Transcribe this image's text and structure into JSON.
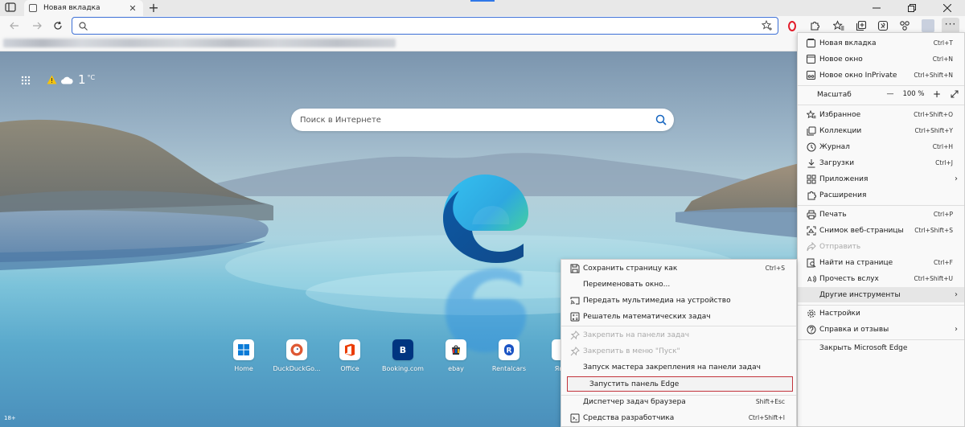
{
  "tab": {
    "title": "Новая вкладка"
  },
  "address": {
    "value": "",
    "placeholder": ""
  },
  "page": {
    "weather_temp": "1",
    "weather_unit": "°C",
    "search_placeholder": "Поиск в Интернете",
    "age_badge": "18+",
    "tiles": [
      {
        "label": "Home",
        "icon": "windows-logo"
      },
      {
        "label": "DuckDuckGo...",
        "icon": "duckduckgo-logo"
      },
      {
        "label": "Office",
        "icon": "office-logo"
      },
      {
        "label": "Booking.com",
        "icon": "booking-logo",
        "glyph": "B"
      },
      {
        "label": "ebay",
        "icon": "ebay-logo"
      },
      {
        "label": "Rentalcars",
        "icon": "rentalcars-logo",
        "glyph": "R"
      },
      {
        "label": "Ян...",
        "icon": "yandex-logo"
      }
    ]
  },
  "main_menu": {
    "new_tab": {
      "label": "Новая вкладка",
      "shortcut": "Ctrl+T"
    },
    "new_window": {
      "label": "Новое окно",
      "shortcut": "Ctrl+N"
    },
    "inprivate": {
      "label": "Новое окно InPrivate",
      "shortcut": "Ctrl+Shift+N"
    },
    "zoom": {
      "label": "Масштаб",
      "minus": "—",
      "value": "100 %",
      "plus": "+"
    },
    "favorites": {
      "label": "Избранное",
      "shortcut": "Ctrl+Shift+O"
    },
    "collections": {
      "label": "Коллекции",
      "shortcut": "Ctrl+Shift+Y"
    },
    "history": {
      "label": "Журнал",
      "shortcut": "Ctrl+H"
    },
    "downloads": {
      "label": "Загрузки",
      "shortcut": "Ctrl+J"
    },
    "apps": {
      "label": "Приложения"
    },
    "extensions": {
      "label": "Расширения"
    },
    "print": {
      "label": "Печать",
      "shortcut": "Ctrl+P"
    },
    "screenshot": {
      "label": "Снимок веб-страницы",
      "shortcut": "Ctrl+Shift+S"
    },
    "share": {
      "label": "Отправить"
    },
    "find": {
      "label": "Найти на странице",
      "shortcut": "Ctrl+F"
    },
    "read_aloud": {
      "label": "Прочесть вслух",
      "shortcut": "Ctrl+Shift+U"
    },
    "more_tools": {
      "label": "Другие инструменты"
    },
    "settings": {
      "label": "Настройки"
    },
    "help": {
      "label": "Справка и отзывы"
    },
    "close_edge": {
      "label": "Закрыть Microsoft Edge"
    }
  },
  "sub_menu": {
    "save_page": {
      "label": "Сохранить страницу как",
      "shortcut": "Ctrl+S"
    },
    "rename_window": {
      "label": "Переименовать окно..."
    },
    "cast_media": {
      "label": "Передать мультимедиа на устройство"
    },
    "math_solver": {
      "label": "Решатель математических задач"
    },
    "pin_taskbar": {
      "label": "Закрепить на панели задач"
    },
    "pin_start": {
      "label": "Закрепить в меню \"Пуск\""
    },
    "pin_wizard": {
      "label": "Запуск мастера закрепления на панели задач"
    },
    "edge_bar": {
      "label": "Запустить панель Edge"
    },
    "task_manager": {
      "label": "Диспетчер задач браузера",
      "shortcut": "Shift+Esc"
    },
    "dev_tools": {
      "label": "Средства разработчика",
      "shortcut": "Ctrl+Shift+I"
    }
  }
}
